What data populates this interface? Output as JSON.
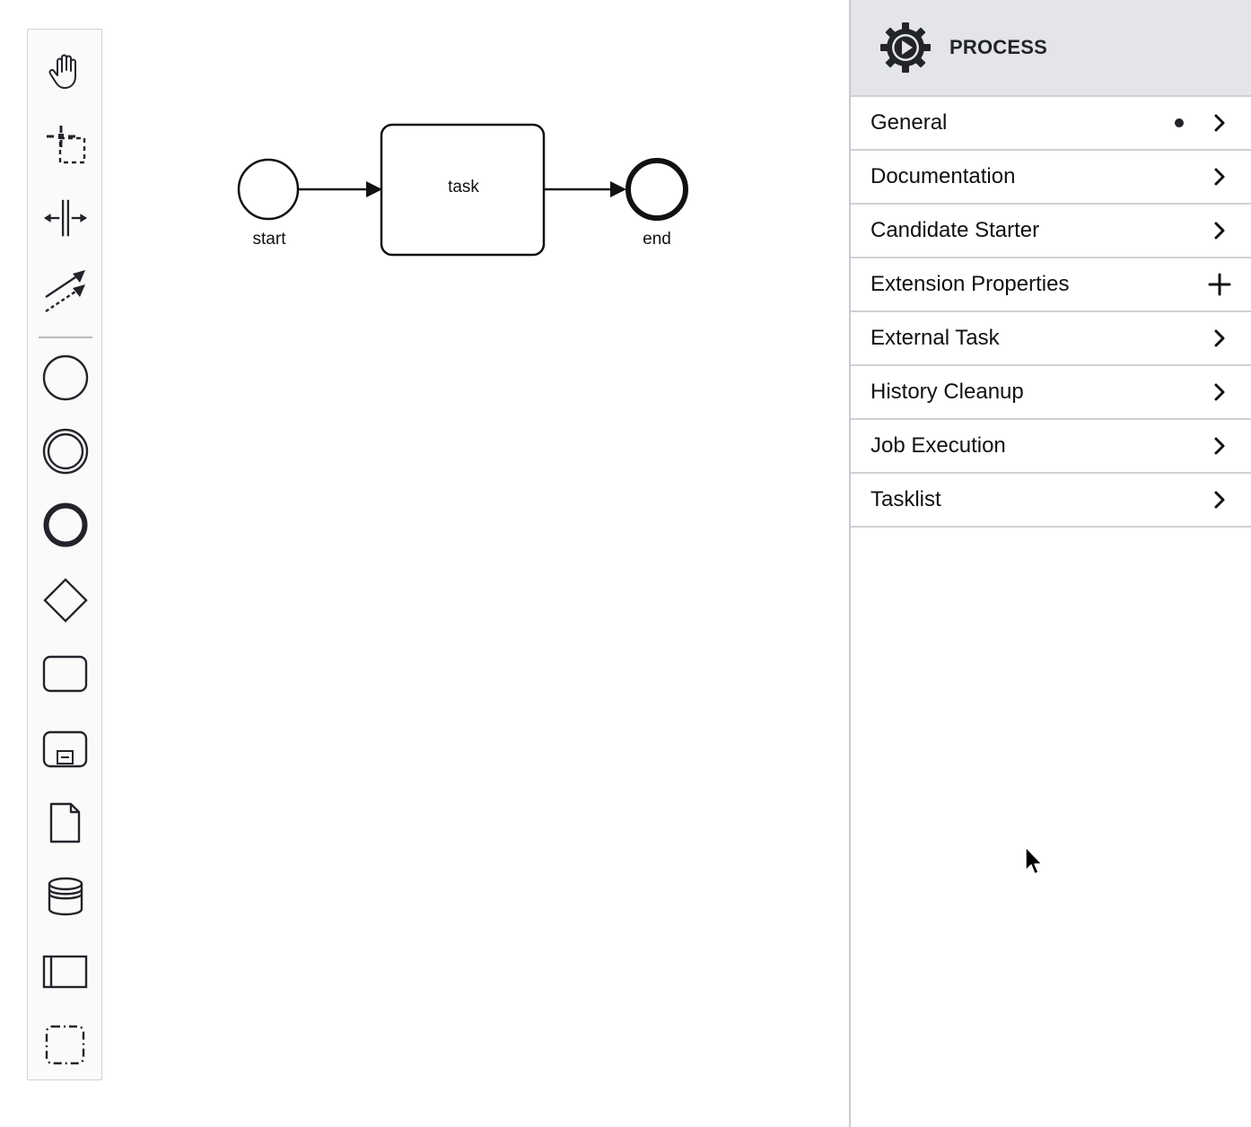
{
  "palette": {
    "tools": [
      {
        "name": "hand-tool",
        "icon": "hand-icon"
      },
      {
        "name": "lasso-tool",
        "icon": "lasso-icon"
      },
      {
        "name": "space-tool",
        "icon": "space-tool-icon"
      },
      {
        "name": "global-connect-tool",
        "icon": "connect-icon"
      },
      {
        "name": "create-start-event",
        "icon": "start-event-icon"
      },
      {
        "name": "create-intermediate-event",
        "icon": "intermediate-event-icon"
      },
      {
        "name": "create-end-event",
        "icon": "end-event-icon"
      },
      {
        "name": "create-gateway",
        "icon": "gateway-icon"
      },
      {
        "name": "create-task",
        "icon": "task-icon"
      },
      {
        "name": "create-subprocess",
        "icon": "subprocess-icon"
      },
      {
        "name": "create-data-object",
        "icon": "data-object-icon"
      },
      {
        "name": "create-data-store",
        "icon": "data-store-icon"
      },
      {
        "name": "create-pool",
        "icon": "pool-icon"
      },
      {
        "name": "create-group",
        "icon": "group-icon"
      }
    ]
  },
  "diagram": {
    "start_label": "start",
    "task_label": "task",
    "end_label": "end"
  },
  "panel": {
    "header_title": "PROCESS",
    "header_icon": "process-gear-icon",
    "groups": [
      {
        "label": "General",
        "has_dot": true,
        "action": "chevron-right-icon"
      },
      {
        "label": "Documentation",
        "has_dot": false,
        "action": "chevron-right-icon"
      },
      {
        "label": "Candidate Starter",
        "has_dot": false,
        "action": "chevron-right-icon"
      },
      {
        "label": "Extension Properties",
        "has_dot": false,
        "action": "plus-icon"
      },
      {
        "label": "External Task",
        "has_dot": false,
        "action": "chevron-right-icon"
      },
      {
        "label": "History Cleanup",
        "has_dot": false,
        "action": "chevron-right-icon"
      },
      {
        "label": "Job Execution",
        "has_dot": false,
        "action": "chevron-right-icon"
      },
      {
        "label": "Tasklist",
        "has_dot": false,
        "action": "chevron-right-icon"
      }
    ]
  },
  "colors": {
    "stroke": "#22242a",
    "panel_header_bg": "#e3e5e9",
    "border": "#cfd1d6"
  }
}
